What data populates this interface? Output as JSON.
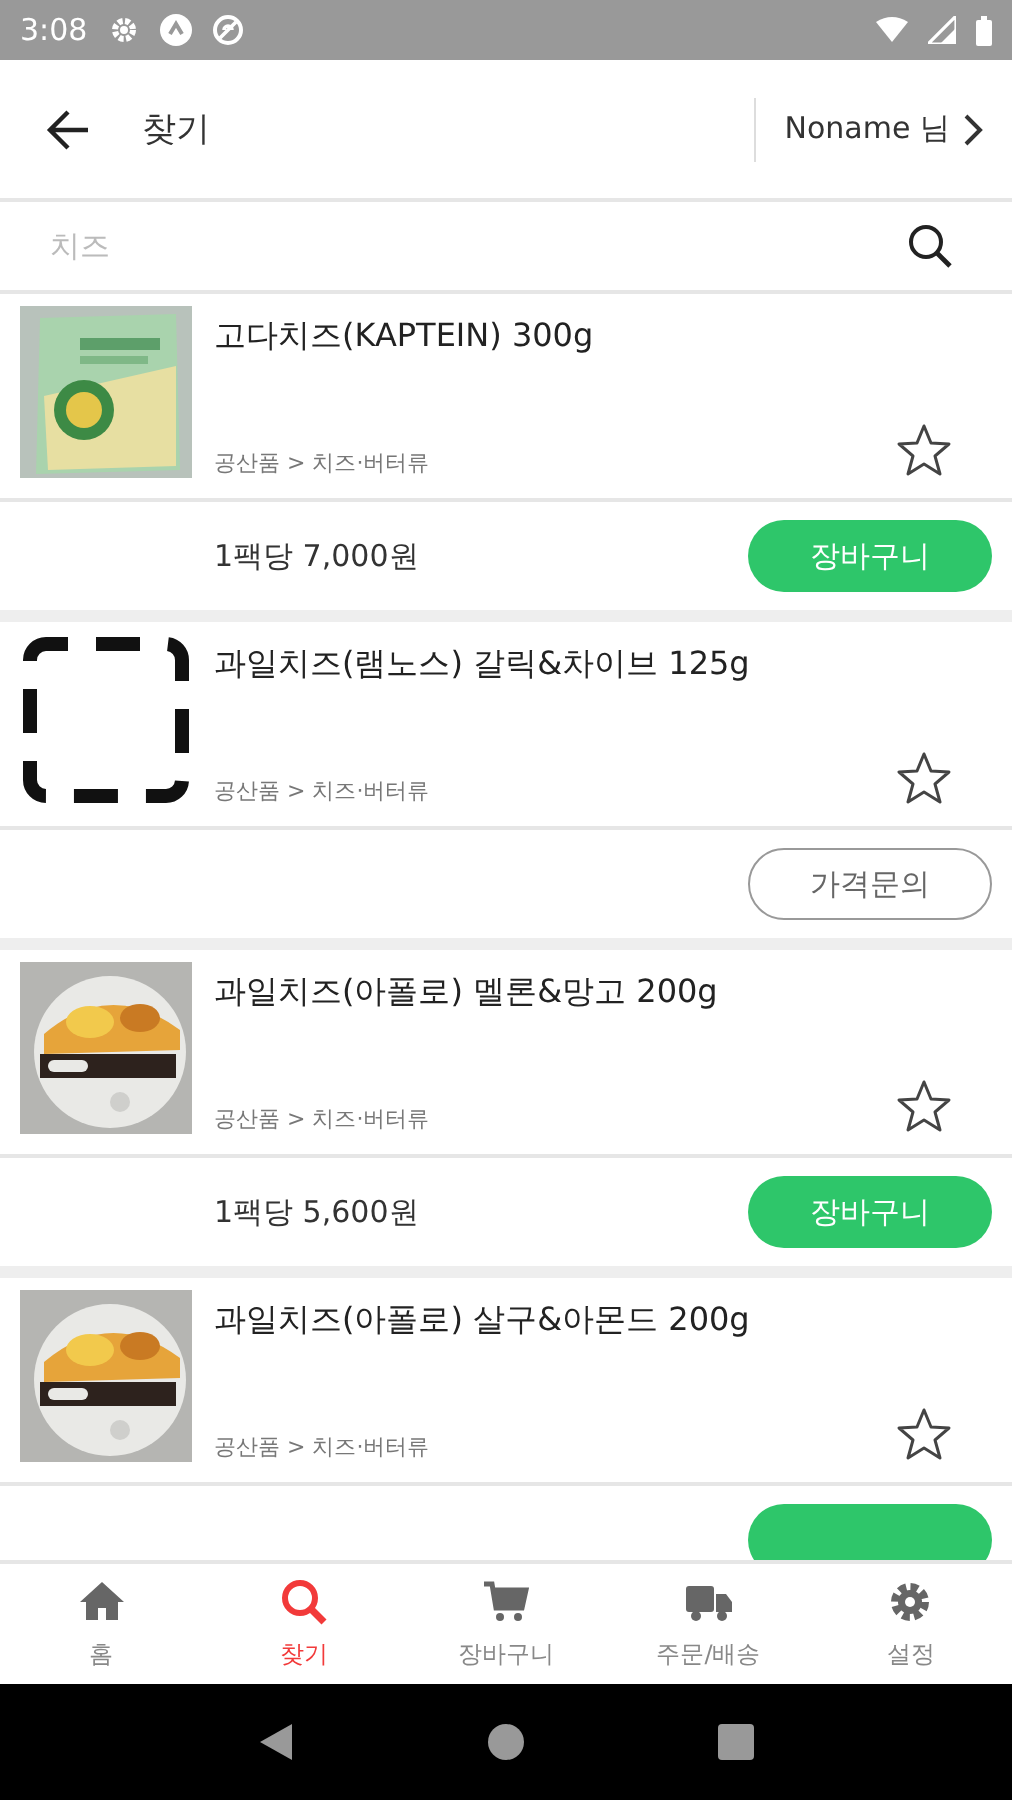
{
  "status_bar": {
    "time": "3:08"
  },
  "header": {
    "title": "찾기",
    "user": "Noname 님"
  },
  "search": {
    "placeholder": "치즈"
  },
  "products": [
    {
      "name": "고다치즈(KAPTEIN) 300g",
      "category": "공산품 > 치즈·버터류",
      "favorite": false,
      "price": "1팩당 7,000원",
      "action": {
        "kind": "cart",
        "label": "장바구니"
      }
    },
    {
      "name": "과일치즈(램노스) 갈릭&차이브 125g",
      "category": "공산품 > 치즈·버터류",
      "image": {
        "kind": "placeholder"
      },
      "favorite": false,
      "action": {
        "kind": "inquiry",
        "label": "가격문의"
      }
    },
    {
      "name": "과일치즈(아폴로) 멜론&망고 200g",
      "category": "공산품 > 치즈·버터류",
      "favorite": false,
      "price": "1팩당 5,600원",
      "action": {
        "kind": "cart",
        "label": "장바구니"
      }
    },
    {
      "name": "과일치즈(아폴로) 살구&아몬드 200g",
      "category": "공산품 > 치즈·버터류",
      "favorite": false,
      "action": {
        "kind": "cart"
      }
    }
  ],
  "bottom_nav": [
    {
      "label": "홈",
      "selected": false
    },
    {
      "label": "찾기",
      "selected": true
    },
    {
      "label": "장바구니",
      "selected": false
    },
    {
      "label": "주문/배송",
      "selected": false
    },
    {
      "label": "설정",
      "selected": false
    }
  ]
}
